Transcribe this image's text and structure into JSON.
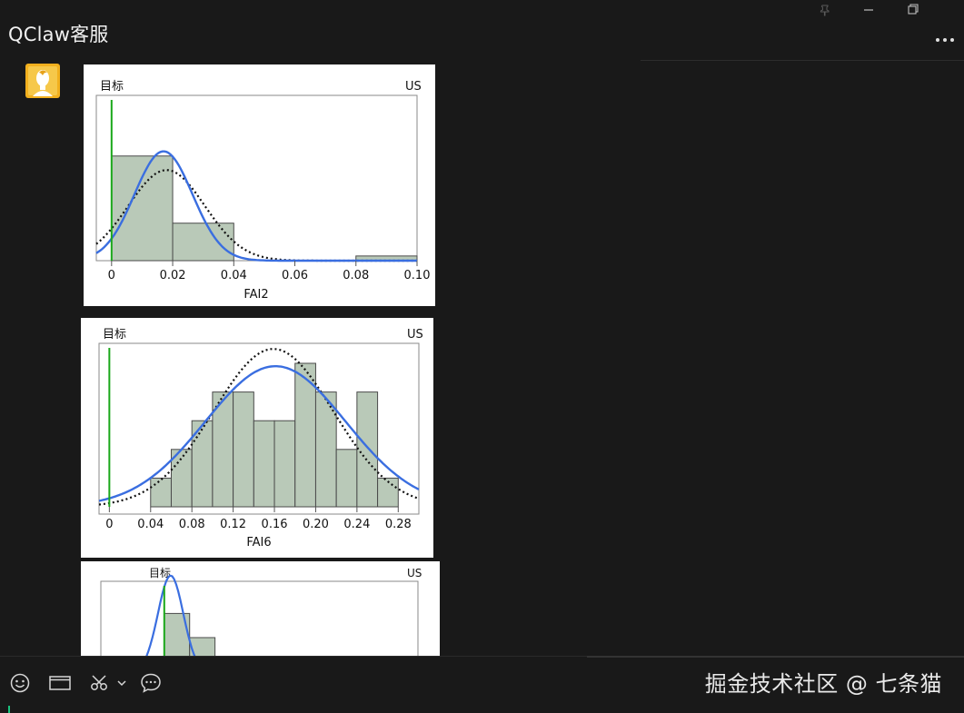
{
  "window": {
    "title": "QClaw客服",
    "controls": [
      "pin-icon",
      "minimize-icon",
      "restore-icon"
    ],
    "more_icon": "ellipsis-icon"
  },
  "message": {
    "avatar_icon": "user-avatar-icon"
  },
  "colors": {
    "background": "#191919",
    "bar_fill": "#b9c9b8",
    "curve_blue": "#3a6ee0",
    "target_green": "#1aa81a",
    "accent_green": "#19c37d"
  },
  "chart_data": [
    {
      "type": "bar",
      "xlabel": "FAI2",
      "top_left_label": "目标",
      "top_right_label": "US",
      "xlim": [
        -0.005,
        0.1
      ],
      "ticks": [
        "0",
        "0.02",
        "0.04",
        "0.06",
        "0.08",
        "0.10"
      ],
      "tick_values": [
        0,
        0.02,
        0.04,
        0.06,
        0.08,
        0.1
      ],
      "target": 0,
      "bins": [
        [
          0,
          0.02,
          0.67
        ],
        [
          0.02,
          0.04,
          0.24
        ],
        [
          0.08,
          0.1,
          0.03
        ]
      ],
      "fit_normal": {
        "mean": 0.017,
        "sd": 0.0095,
        "peak": 0.7
      },
      "fit_dotted": {
        "mean": 0.018,
        "sd": 0.0125,
        "peak": 0.58
      }
    },
    {
      "type": "bar",
      "xlabel": "FAI6",
      "top_left_label": "目标",
      "top_right_label": "US",
      "xlim": [
        -0.01,
        0.3
      ],
      "ticks": [
        "0",
        "0.04",
        "0.08",
        "0.12",
        "0.16",
        "0.20",
        "0.24",
        "0.28"
      ],
      "tick_values": [
        0,
        0.04,
        0.08,
        0.12,
        0.16,
        0.2,
        0.24,
        0.28
      ],
      "target": 0,
      "bins": [
        [
          0.04,
          0.06,
          0.2
        ],
        [
          0.06,
          0.08,
          0.4
        ],
        [
          0.08,
          0.1,
          0.6
        ],
        [
          0.1,
          0.12,
          0.8
        ],
        [
          0.12,
          0.14,
          0.8
        ],
        [
          0.14,
          0.16,
          0.6
        ],
        [
          0.16,
          0.18,
          0.6
        ],
        [
          0.18,
          0.2,
          1.0
        ],
        [
          0.2,
          0.22,
          0.8
        ],
        [
          0.22,
          0.24,
          0.4
        ],
        [
          0.24,
          0.26,
          0.8
        ],
        [
          0.26,
          0.28,
          0.2
        ]
      ],
      "fit_normal": {
        "mean": 0.161,
        "sd": 0.068,
        "peak": 0.98
      },
      "fit_dotted": {
        "mean": 0.159,
        "sd": 0.058,
        "peak": 1.1
      }
    },
    {
      "type": "bar",
      "top_left_label": "目标",
      "top_right_label": "US",
      "xlim": [
        -1.0,
        4.0
      ],
      "target": 0,
      "bins": [
        [
          -0.4,
          0.0,
          0.1
        ],
        [
          0.0,
          0.4,
          0.85
        ],
        [
          0.4,
          0.8,
          0.5
        ]
      ],
      "fit_normal": {
        "mean": 0.1,
        "sd": 0.2,
        "peak": 1.4
      },
      "fit_dotted": null
    }
  ],
  "toolbar": {
    "items": [
      "emoji-icon",
      "screen-window-icon",
      "scissors-icon",
      "chevron-down-icon",
      "chat-bubble-icon"
    ]
  },
  "watermark": "掘金技术社区 @ 七条猫"
}
